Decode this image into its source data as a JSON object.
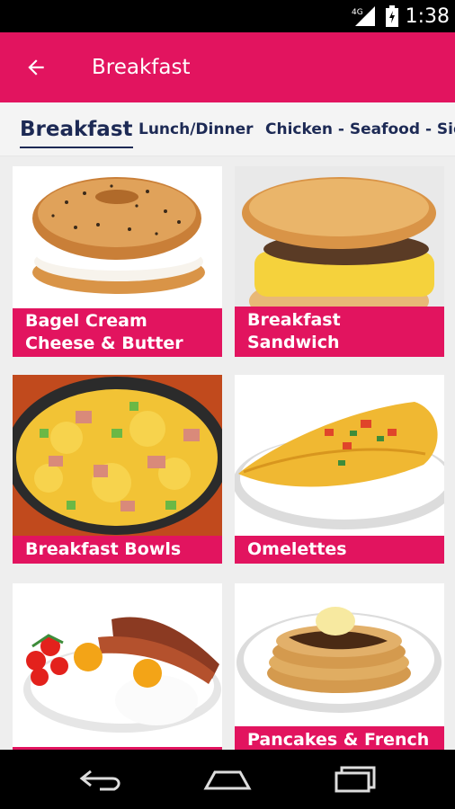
{
  "status_bar": {
    "network": "4G",
    "time": "1:38"
  },
  "app_bar": {
    "title": "Breakfast",
    "back_icon": "arrow-back-icon"
  },
  "tabs": [
    {
      "label": "Breakfast",
      "active": true
    },
    {
      "label": "Lunch/Dinner",
      "active": false
    },
    {
      "label": "Chicken - Seafood - Sides",
      "active": false
    }
  ],
  "menu_items": [
    {
      "label": "Bagel Cream Cheese & Butter"
    },
    {
      "label": "Breakfast Sandwich"
    },
    {
      "label": "Breakfast Bowls"
    },
    {
      "label": "Omelettes"
    },
    {
      "label": ""
    },
    {
      "label": "Pancakes & French"
    }
  ],
  "nav_bar": {
    "back_icon": "nav-back-icon",
    "home_icon": "nav-home-icon",
    "recents_icon": "nav-recents-icon"
  },
  "colors": {
    "accent": "#e2145f",
    "tab_text": "#1d2a55",
    "status_bar": "#000000",
    "background": "#eeeeee"
  }
}
